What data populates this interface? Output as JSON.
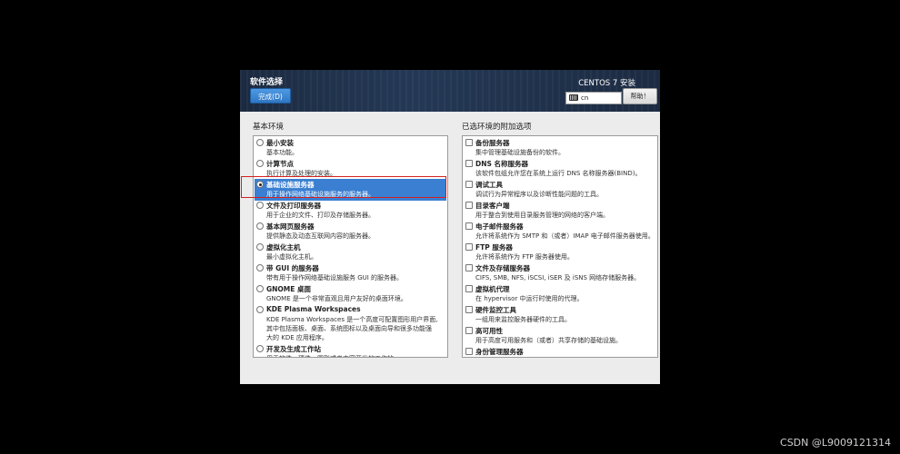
{
  "header": {
    "title": "软件选择",
    "done_label": "完成(D)",
    "product": "CENTOS 7 安装",
    "keyboard_layout": "cn",
    "help_label": "帮助！"
  },
  "left": {
    "heading": "基本环境",
    "items": [
      {
        "title": "最小安装",
        "desc": [
          "基本功能。"
        ],
        "selected": false
      },
      {
        "title": "计算节点",
        "desc": [
          "执行计算及处理的安装。"
        ],
        "selected": false
      },
      {
        "title": "基础设施服务器",
        "desc": [
          "用于操作网络基础设施服务的服务器。"
        ],
        "selected": true
      },
      {
        "title": "文件及打印服务器",
        "desc": [
          "用于企业的文件、打印及存储服务器。"
        ],
        "selected": false
      },
      {
        "title": "基本网页服务器",
        "desc": [
          "提供静态及动态互联网内容的服务器。"
        ],
        "selected": false
      },
      {
        "title": "虚拟化主机",
        "desc": [
          "最小虚拟化主机。"
        ],
        "selected": false
      },
      {
        "title": "带 GUI 的服务器",
        "desc": [
          "带有用于操作网络基础设施服务 GUI 的服务器。"
        ],
        "selected": false
      },
      {
        "title": "GNOME 桌面",
        "desc": [
          "GNOME 是一个非常直观且用户友好的桌面环境。"
        ],
        "selected": false
      },
      {
        "title": "KDE Plasma Workspaces",
        "desc": [
          "KDE Plasma Workspaces 是一个高度可配置图形用户界面,",
          "其中包括面板、桌面、系统图标以及桌面向导和很多功能强",
          "大的 KDE 应用程序。"
        ],
        "selected": false
      },
      {
        "title": "开发及生成工作站",
        "desc": [
          "用于软件、硬件、图形或者内容开发的工作站。"
        ],
        "selected": false
      }
    ]
  },
  "right": {
    "heading": "已选环境的附加选项",
    "items": [
      {
        "title": "备份服务器",
        "desc": [
          "集中管理基础设施备份的软件。"
        ]
      },
      {
        "title": "DNS 名称服务器",
        "desc": [
          "该软件包组允许您在系统上运行 DNS 名称服务器(BIND)。"
        ]
      },
      {
        "title": "调试工具",
        "desc": [
          "调试行为异常程序以及诊断性能问题的工具。"
        ]
      },
      {
        "title": "目录客户端",
        "desc": [
          "用于整合到使用目录服务管理的网络的客户端。"
        ]
      },
      {
        "title": "电子邮件服务器",
        "desc": [
          "允许将系统作为 SMTP 和（或者）IMAP 电子邮件服务器使用。"
        ]
      },
      {
        "title": "FTP 服务器",
        "desc": [
          "允许将系统作为 FTP 服务器使用。"
        ]
      },
      {
        "title": "文件及存储服务器",
        "desc": [
          "CIFS, SMB, NFS, iSCSI, iSER 及 iSNS 网络存储服务器。"
        ]
      },
      {
        "title": "虚拟机代理",
        "desc": [
          "在 hypervisor 中运行时使用的代理。"
        ]
      },
      {
        "title": "硬件监控工具",
        "desc": [
          "一组用来监控服务器硬件的工具。"
        ]
      },
      {
        "title": "高可用性",
        "desc": [
          "用于高度可用服务和（或者）共享存储的基础设施。"
        ]
      },
      {
        "title": "身份管理服务器",
        "desc": [
          ""
        ]
      }
    ]
  },
  "watermark": "CSDN @L9009121314"
}
